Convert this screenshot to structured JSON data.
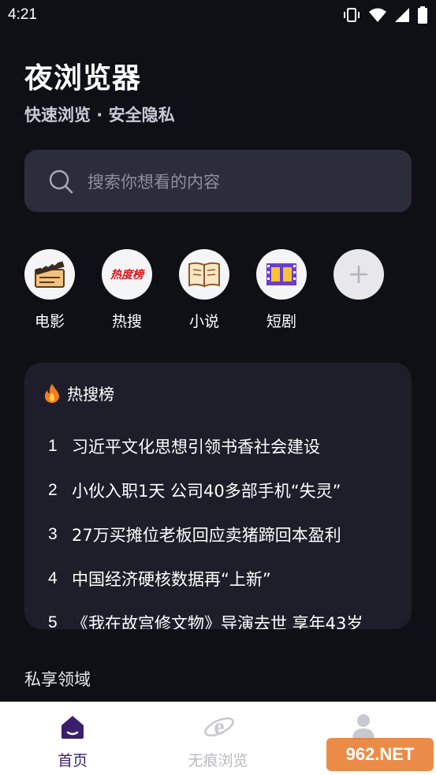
{
  "status_bar": {
    "time": "4:21"
  },
  "header": {
    "title": "夜浏览器",
    "subtitle": "快速浏览 · 安全隐私"
  },
  "search": {
    "placeholder": "搜索你想看的内容"
  },
  "shortcuts": [
    {
      "label": "电影",
      "icon": "movie-clapper-icon"
    },
    {
      "label": "热搜",
      "icon": "hot-search-logo-icon",
      "logo_text": "热度榜"
    },
    {
      "label": "小说",
      "icon": "open-book-icon"
    },
    {
      "label": "短剧",
      "icon": "film-strip-icon"
    },
    {
      "label": "",
      "icon": "add-icon"
    }
  ],
  "hot_list": {
    "title": "热搜榜",
    "items": [
      {
        "rank": "1",
        "text": "习近平文化思想引领书香社会建设"
      },
      {
        "rank": "2",
        "text": "小伙入职1天 公司40多部手机“失灵”"
      },
      {
        "rank": "3",
        "text": "27万买摊位老板回应卖猪蹄回本盈利"
      },
      {
        "rank": "4",
        "text": "中国经济硬核数据再“上新”"
      },
      {
        "rank": "5",
        "text": "《我在故宫修文物》导演去世 享年43岁"
      }
    ]
  },
  "private_section": {
    "title": "私享领域"
  },
  "bottom_nav": {
    "items": [
      {
        "label": "首页",
        "icon": "home-icon",
        "active": true
      },
      {
        "label": "无痕浏览",
        "icon": "browser-e-icon",
        "active": false
      },
      {
        "label": "",
        "icon": "user-profile-icon",
        "active": false
      }
    ]
  },
  "watermark": {
    "text": "962.NET"
  },
  "colors": {
    "background": "#0f1016",
    "search_bg": "#2b2d3a",
    "card_bg": "#1d1e29",
    "active_nav": "#3a1f6b"
  }
}
